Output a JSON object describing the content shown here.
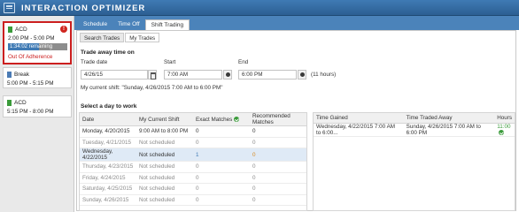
{
  "app": {
    "title": "INTERACTION OPTIMIZER"
  },
  "schedule_cards": [
    {
      "name": "ACD",
      "time": "2:00 PM - 5:00 PM",
      "remaining": "1:34:02 remaining",
      "remaining_fraction": 0.52,
      "status": "Out Of Adherence",
      "alert": "!"
    },
    {
      "name": "Break",
      "time": "5:00 PM - 5:15 PM"
    },
    {
      "name": "ACD",
      "time": "5:15 PM - 8:00 PM"
    }
  ],
  "tabs": [
    "Schedule",
    "Time Off",
    "Shift Trading"
  ],
  "subtabs": [
    "Search Trades",
    "My Trades"
  ],
  "trade_away": {
    "heading": "Trade away time on",
    "trade_date_label": "Trade date",
    "start_label": "Start",
    "end_label": "End",
    "trade_date": "4/26/15",
    "start": "7:00 AM",
    "end": "6:00 PM",
    "hours": "(11 hours)",
    "current_shift": "My current shift: \"Sunday, 4/26/2015 7:00 AM to 6:00 PM\""
  },
  "select_day": {
    "heading": "Select a day to work",
    "columns": [
      "Date",
      "My Current Shift",
      "Exact Matches",
      "Recommended Matches"
    ],
    "rows": [
      {
        "date": "Monday, 4/20/2015",
        "shift": "9:00 AM to 8:00 PM",
        "exact": "0",
        "rec": "0"
      },
      {
        "date": "Tuesday, 4/21/2015",
        "shift": "Not scheduled",
        "exact": "0",
        "rec": "0"
      },
      {
        "date": "Wednesday, 4/22/2015",
        "shift": "Not scheduled",
        "exact": "1",
        "rec": "0"
      },
      {
        "date": "Thursday, 4/23/2015",
        "shift": "Not scheduled",
        "exact": "0",
        "rec": "0"
      },
      {
        "date": "Friday, 4/24/2015",
        "shift": "Not scheduled",
        "exact": "0",
        "rec": "0"
      },
      {
        "date": "Saturday, 4/25/2015",
        "shift": "Not scheduled",
        "exact": "0",
        "rec": "0"
      },
      {
        "date": "Sunday, 4/26/2015",
        "shift": "Not scheduled",
        "exact": "0",
        "rec": "0"
      }
    ]
  },
  "trades": {
    "columns": [
      "Time Gained",
      "Time Traded Away",
      "Hours"
    ],
    "rows": [
      {
        "gained": "Wednesday, 4/22/2015 7:00 AM to 6:00...",
        "away": "Sunday, 4/26/2015 7:00 AM to 6:00 PM",
        "hours": "11:00"
      }
    ]
  }
}
